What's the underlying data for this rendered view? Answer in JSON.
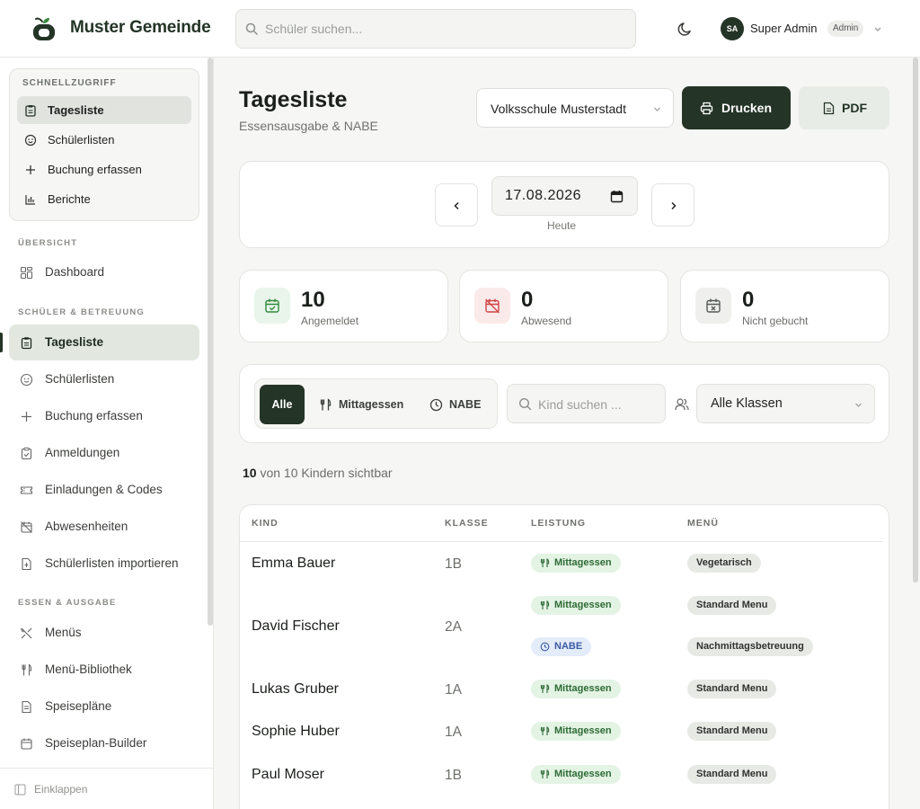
{
  "app": {
    "title": "Muster Gemeinde"
  },
  "header": {
    "search_placeholder": "Schüler suchen...",
    "user_name": "Super Admin",
    "user_initials": "SA",
    "user_role": "Admin"
  },
  "sidebar": {
    "quick_title": "SCHNELLZUGRIFF",
    "quick_items": [
      {
        "label": "Tagesliste",
        "icon": "clipboard-icon",
        "active": true
      },
      {
        "label": "Schülerlisten",
        "icon": "smile-icon"
      },
      {
        "label": "Buchung erfassen",
        "icon": "plus-icon"
      },
      {
        "label": "Berichte",
        "icon": "bar-chart-icon"
      }
    ],
    "section_overview": "ÜBERSICHT",
    "overview_items": [
      {
        "label": "Dashboard",
        "icon": "grid-icon"
      }
    ],
    "section_students": "SCHÜLER & BETREUUNG",
    "student_items": [
      {
        "label": "Tagesliste",
        "icon": "clipboard-icon",
        "active": true
      },
      {
        "label": "Schülerlisten",
        "icon": "smile-icon"
      },
      {
        "label": "Buchung erfassen",
        "icon": "plus-icon"
      },
      {
        "label": "Anmeldungen",
        "icon": "clipboard-check-icon"
      },
      {
        "label": "Einladungen & Codes",
        "icon": "ticket-icon"
      },
      {
        "label": "Abwesenheiten",
        "icon": "calendar-off-icon"
      },
      {
        "label": "Schülerlisten importieren",
        "icon": "file-import-icon"
      }
    ],
    "section_food": "ESSEN & AUSGABE",
    "food_items": [
      {
        "label": "Menüs",
        "icon": "utensils-crossed-icon"
      },
      {
        "label": "Menü-Bibliothek",
        "icon": "fork-knife-icon"
      },
      {
        "label": "Speisepläne",
        "icon": "document-icon"
      },
      {
        "label": "Speiseplan-Builder",
        "icon": "calendar-icon"
      }
    ],
    "collapse_label": "Einklappen"
  },
  "page": {
    "title": "Tagesliste",
    "subtitle": "Essensausgabe & NABE",
    "school": "Volksschule Musterstadt",
    "print_label": "Drucken",
    "pdf_label": "PDF"
  },
  "date_nav": {
    "date": "17.08.2026",
    "caption": "Heute"
  },
  "stats": [
    {
      "value": "10",
      "label": "Angemeldet",
      "color": "#2f8a3b"
    },
    {
      "value": "0",
      "label": "Abwesend",
      "color": "#d04444"
    },
    {
      "value": "0",
      "label": "Nicht gebucht",
      "color": "#555a55"
    }
  ],
  "filters": {
    "all_label": "Alle",
    "lunch_label": "Mittagessen",
    "nabe_label": "NABE",
    "search_placeholder": "Kind suchen ...",
    "class_select": "Alle Klassen"
  },
  "count": {
    "visible": "10",
    "text": "von 10 Kindern sichtbar"
  },
  "table": {
    "headers": {
      "kind": "KIND",
      "klasse": "KLASSE",
      "leistung": "LEISTUNG",
      "menue": "MENÜ"
    },
    "rows": [
      {
        "name": "Emma Bauer",
        "klasse": "1B",
        "services": [
          {
            "label": "Mittagessen",
            "type": "lunch",
            "menu": "Vegetarisch"
          }
        ]
      },
      {
        "name": "David Fischer",
        "klasse": "2A",
        "services": [
          {
            "label": "Mittagessen",
            "type": "lunch",
            "menu": "Standard Menu"
          },
          {
            "label": "NABE",
            "type": "nabe",
            "menu": "Nachmittagsbetreuung"
          }
        ]
      },
      {
        "name": "Lukas Gruber",
        "klasse": "1A",
        "services": [
          {
            "label": "Mittagessen",
            "type": "lunch",
            "menu": "Standard Menu"
          }
        ]
      },
      {
        "name": "Sophie Huber",
        "klasse": "1A",
        "services": [
          {
            "label": "Mittagessen",
            "type": "lunch",
            "menu": "Standard Menu"
          }
        ]
      },
      {
        "name": "Paul Moser",
        "klasse": "1B",
        "services": [
          {
            "label": "Mittagessen",
            "type": "lunch",
            "menu": "Standard Menu"
          }
        ]
      }
    ]
  },
  "colors": {
    "brand": "#243426",
    "accent_green": "#2f8a3b",
    "nabe_blue": "#3a5aa1"
  }
}
